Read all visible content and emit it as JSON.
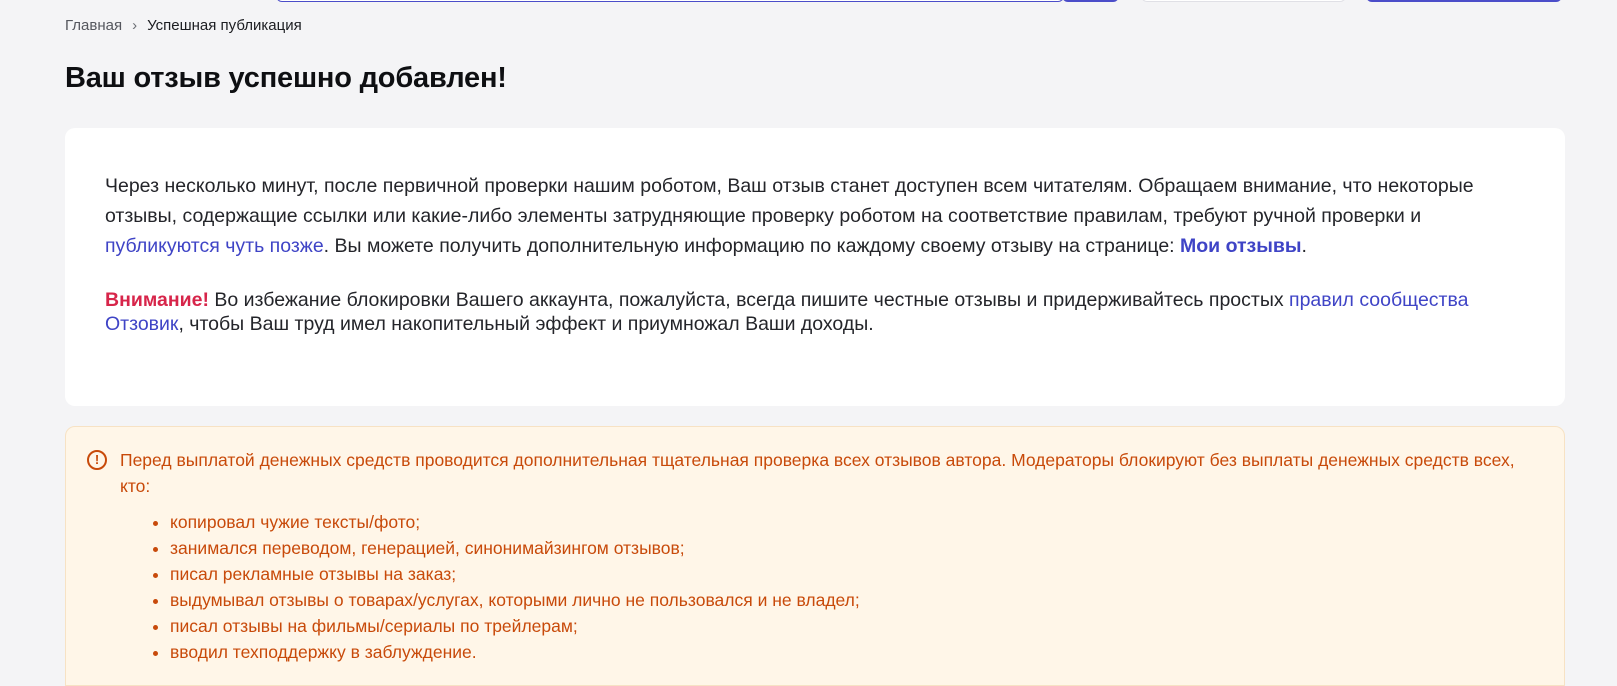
{
  "breadcrumb": {
    "home": "Главная",
    "separator": "›",
    "current": "Успешная публикация"
  },
  "page_title": "Ваш отзыв успешно добавлен!",
  "card": {
    "p1_part1": "Через несколько минут, после первичной проверки нашим роботом, Ваш отзыв станет доступен всем читателям. Обращаем внимание, что некоторые отзывы, содержащие ссылки или какие-либо элементы затрудняющие проверку роботом на соответствие правилам, требуют ручной проверки и ",
    "p1_link": "публикуются чуть позже",
    "p1_part2": ". Вы можете получить дополнительную информацию по каждому своему отзыву на странице: ",
    "my_reviews_link": "Мои отзывы",
    "p1_end": ".",
    "attention_label": "Внимание!",
    "p2_part1": " Во избежание блокировки Вашего аккаунта, пожалуйста, всегда пишите честные отзывы и придерживайтесь простых ",
    "rules_link": "правил сообщества Отзовик",
    "p2_part2": ", чтобы Ваш труд имел накопительный эффект и приумножал Ваши доходы."
  },
  "warning": {
    "icon": "exclamation-circle-icon",
    "icon_glyph": "!",
    "lead": "Перед выплатой денежных средств проводится дополнительная тщательная проверка всех отзывов автора. Модераторы блокируют без выплаты денежных средств всех, кто:",
    "items": [
      "копировал чужие тексты/фото;",
      "занимался переводом, генерацией, синонимайзингом отзывов;",
      "писал рекламные отзывы на заказ;",
      "выдумывал отзывы о товарах/услугах, которыми лично не пользовался и не владел;",
      "писал отзывы на фильмы/сериалы по трейлерам;",
      "вводил техподдержку в заблуждение."
    ]
  },
  "colors": {
    "accent": "#3f44c6",
    "attention": "#d7254a",
    "warning_text": "#c84a0a",
    "warning_bg": "#fff6e8",
    "page_bg": "#f4f4f6"
  }
}
